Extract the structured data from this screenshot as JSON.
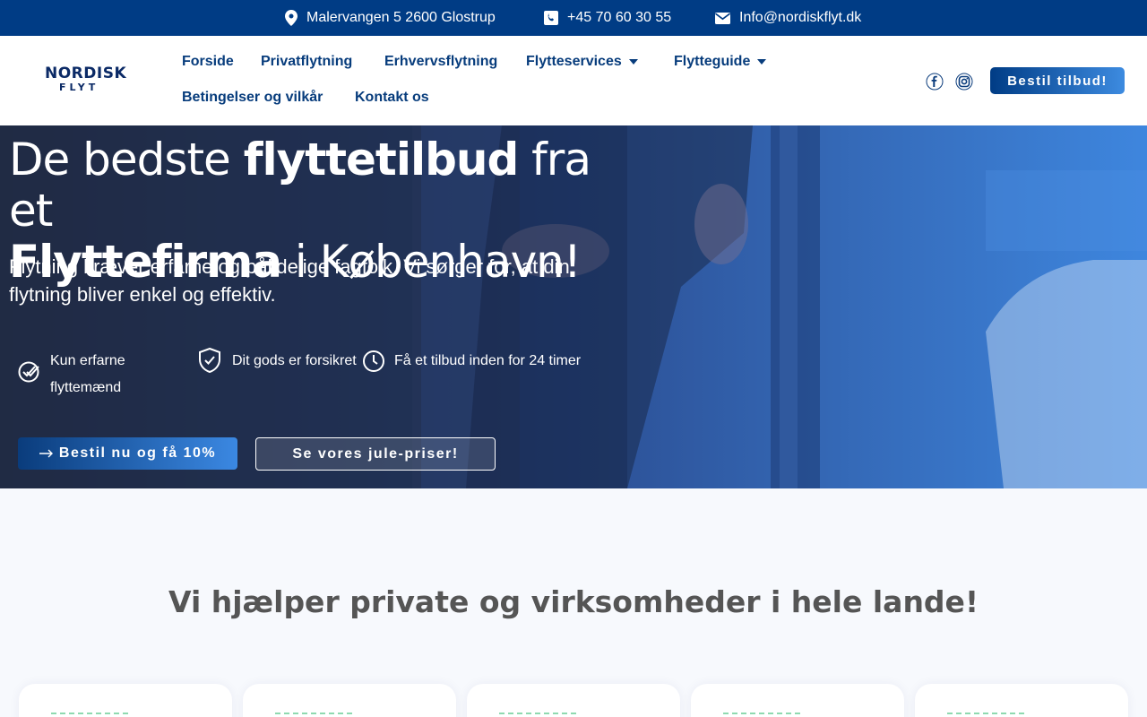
{
  "topbar": {
    "address": "Malervangen 5 2600 Glostrup",
    "phone": "+45 70 60 30 55",
    "email": "Info@nordiskflyt.dk"
  },
  "logo": {
    "line1": "NORDISK",
    "line2": "FLYT"
  },
  "nav": {
    "items": [
      {
        "label": "Forside"
      },
      {
        "label": "Privatflytning"
      },
      {
        "label": "Erhvervsflytning"
      },
      {
        "label": "Flytteservices"
      },
      {
        "label": "Flytteguide"
      },
      {
        "label": "Betingelser og vilkår"
      },
      {
        "label": "Kontakt os"
      }
    ],
    "cta": "Bestil tilbud!"
  },
  "hero": {
    "h1_part1": "De bedste ",
    "h1_bold1": "flyttetilbud",
    "h1_part2": " fra et",
    "h1_bold2": "Flyttefirma",
    "h1_part3": " i København!",
    "subtitle": "Flytning kræver erfarne og pålidelige fagfolk. Vi sørger for, at din flytning bliver enkel og effektiv.",
    "features": [
      {
        "label": "Kun erfarne flyttemænd",
        "icon": "double-check-icon"
      },
      {
        "label": "Dit gods er forsikret",
        "icon": "shield-check-icon"
      },
      {
        "label": "Få et tilbud inden for 24 timer",
        "icon": "clock-icon"
      }
    ],
    "btn_primary": "Bestil nu og få 10%",
    "btn_secondary": "Se vores jule-priser!"
  },
  "section": {
    "title": "Vi hjælper private og virksomheder i hele lande!"
  },
  "colors": {
    "topbar_bg": "#003c85",
    "nav_text": "#073c7c",
    "accent_gradient_start": "#003c85",
    "accent_gradient_end": "#3d8be0"
  }
}
